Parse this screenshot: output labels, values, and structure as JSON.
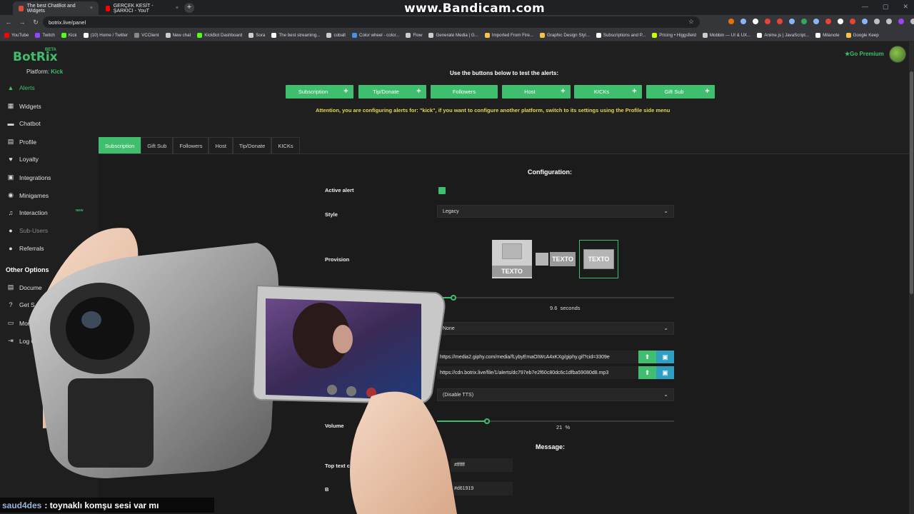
{
  "browser": {
    "tabs": [
      {
        "title": "The best ChatBot and Widgets",
        "close": "×",
        "color": "#e04a3a"
      },
      {
        "title": "GERÇEK KESİT - ŞARKICI - YouT",
        "close": "×",
        "color": "#ff0000"
      }
    ],
    "new_tab": "+",
    "url": "botrix.live/panel",
    "watermark": "www.Bandicam.com",
    "bookmarks": [
      {
        "label": "YouTube",
        "color": "#ff0000"
      },
      {
        "label": "Twitch",
        "color": "#9146ff"
      },
      {
        "label": "Kick",
        "color": "#53fc18"
      },
      {
        "label": "(10) Home / Twitter",
        "color": "#ffffff"
      },
      {
        "label": "VCClient",
        "color": "#888888"
      },
      {
        "label": "New chat",
        "color": "#cccccc"
      },
      {
        "label": "KickBot Dashboard",
        "color": "#53fc18"
      },
      {
        "label": "Sora",
        "color": "#cccccc"
      },
      {
        "label": "The best streaming...",
        "color": "#ffffff"
      },
      {
        "label": "cobalt",
        "color": "#cccccc"
      },
      {
        "label": "Color wheel - color...",
        "color": "#4a90e2"
      },
      {
        "label": "Flow",
        "color": "#cccccc"
      },
      {
        "label": "Generate Media | G...",
        "color": "#cccccc"
      },
      {
        "label": "Imported From Fire...",
        "color": "#f5c542"
      },
      {
        "label": "Graphic Design Styl...",
        "color": "#f5c542"
      },
      {
        "label": "Subscriptions and P...",
        "color": "#ffffff"
      },
      {
        "label": "Pricing • Higgsfield",
        "color": "#c6ff00"
      },
      {
        "label": "Mobbin — UI & UX...",
        "color": "#cccccc"
      },
      {
        "label": "Anime.js | JavaScript...",
        "color": "#ffffff"
      },
      {
        "label": "Milanote",
        "color": "#ffffff"
      },
      {
        "label": "Google Keep",
        "color": "#f5c542"
      }
    ]
  },
  "app": {
    "logo": "BotRix",
    "beta": "BETA",
    "platform_label": "Platform:",
    "platform_value": "Kick",
    "premium": "Go Premium",
    "accent": "#3fbe6e",
    "warning_color": "#e3d94a"
  },
  "sidebar": {
    "items": [
      {
        "label": "Alerts",
        "icon": "warning-icon",
        "glyph": "▲"
      },
      {
        "label": "Widgets",
        "icon": "grid-icon",
        "glyph": "▦"
      },
      {
        "label": "Chatbot",
        "icon": "chat-icon",
        "glyph": "▬"
      },
      {
        "label": "Profile",
        "icon": "profile-icon",
        "glyph": "▤"
      },
      {
        "label": "Loyalty",
        "icon": "trophy-icon",
        "glyph": "♥"
      },
      {
        "label": "Integrations",
        "icon": "integrations-icon",
        "glyph": "▣"
      },
      {
        "label": "Minigames",
        "icon": "gamepad-icon",
        "glyph": "◉"
      },
      {
        "label": "Interaction",
        "icon": "music-icon",
        "glyph": "♫"
      },
      {
        "label": "Sub-Users",
        "icon": "users-icon",
        "glyph": "●"
      },
      {
        "label": "Referrals",
        "icon": "referrals-icon",
        "glyph": "●"
      }
    ],
    "new_badge": "NEW",
    "other_heading": "Other Options",
    "other_items": [
      {
        "label": "Docume",
        "icon": "doc-icon",
        "glyph": "▤"
      },
      {
        "label": "Get S",
        "icon": "help-icon",
        "glyph": "?"
      },
      {
        "label": "Mon",
        "icon": "monitor-icon",
        "glyph": "▭"
      },
      {
        "label": "Log O",
        "icon": "logout-icon",
        "glyph": "⇥"
      }
    ]
  },
  "test": {
    "title": "Use the buttons below to test the alerts:",
    "buttons": [
      {
        "label": "Subscription"
      },
      {
        "label": "Tip/Donate"
      },
      {
        "label": "Followers"
      },
      {
        "label": "Host"
      },
      {
        "label": "KICKs"
      },
      {
        "label": "Gift Sub"
      }
    ],
    "plus": "+",
    "attention": "Attention, you are configuring alerts for: \"kick\", if you want to configure another platform, switch to its settings using the Profile side menu"
  },
  "alert_tabs": [
    "Subscription",
    "Gift Sub",
    "Followers",
    "Host",
    "Tip/Donate",
    "KICKs"
  ],
  "config": {
    "title": "Configuration:",
    "active_alert_label": "Active alert",
    "style_label": "Style",
    "style_value": "Legacy",
    "provision_label": "Provision",
    "provision_texto": "TEXTO",
    "duration_value": "9.6",
    "duration_unit": "seconds",
    "duration_fraction": 0.07,
    "animation_value": "None",
    "image_url": "https://media2.giphy.com/media/fLybyEmaOIWcA4xKXg/giphy.gif?cid=3309e",
    "sound_url": "https://cdn.botrix.live/file/1/alerts/dc797eb7e2f60c80dc6c1dfba59080d8.mp3",
    "tts_value": "(Disable TTS)",
    "volume_label": "Volume",
    "volume_value": "21",
    "volume_unit": "%",
    "volume_fraction": 0.21
  },
  "message": {
    "title": "Message:",
    "top_text_label": "Top text c",
    "top_text_color": "#ffffff",
    "bottom_label": "B",
    "bottom_color": "#d61919"
  },
  "chat": {
    "user": "saud4des",
    "text": ": toynaklı komşu sesi var mı"
  }
}
